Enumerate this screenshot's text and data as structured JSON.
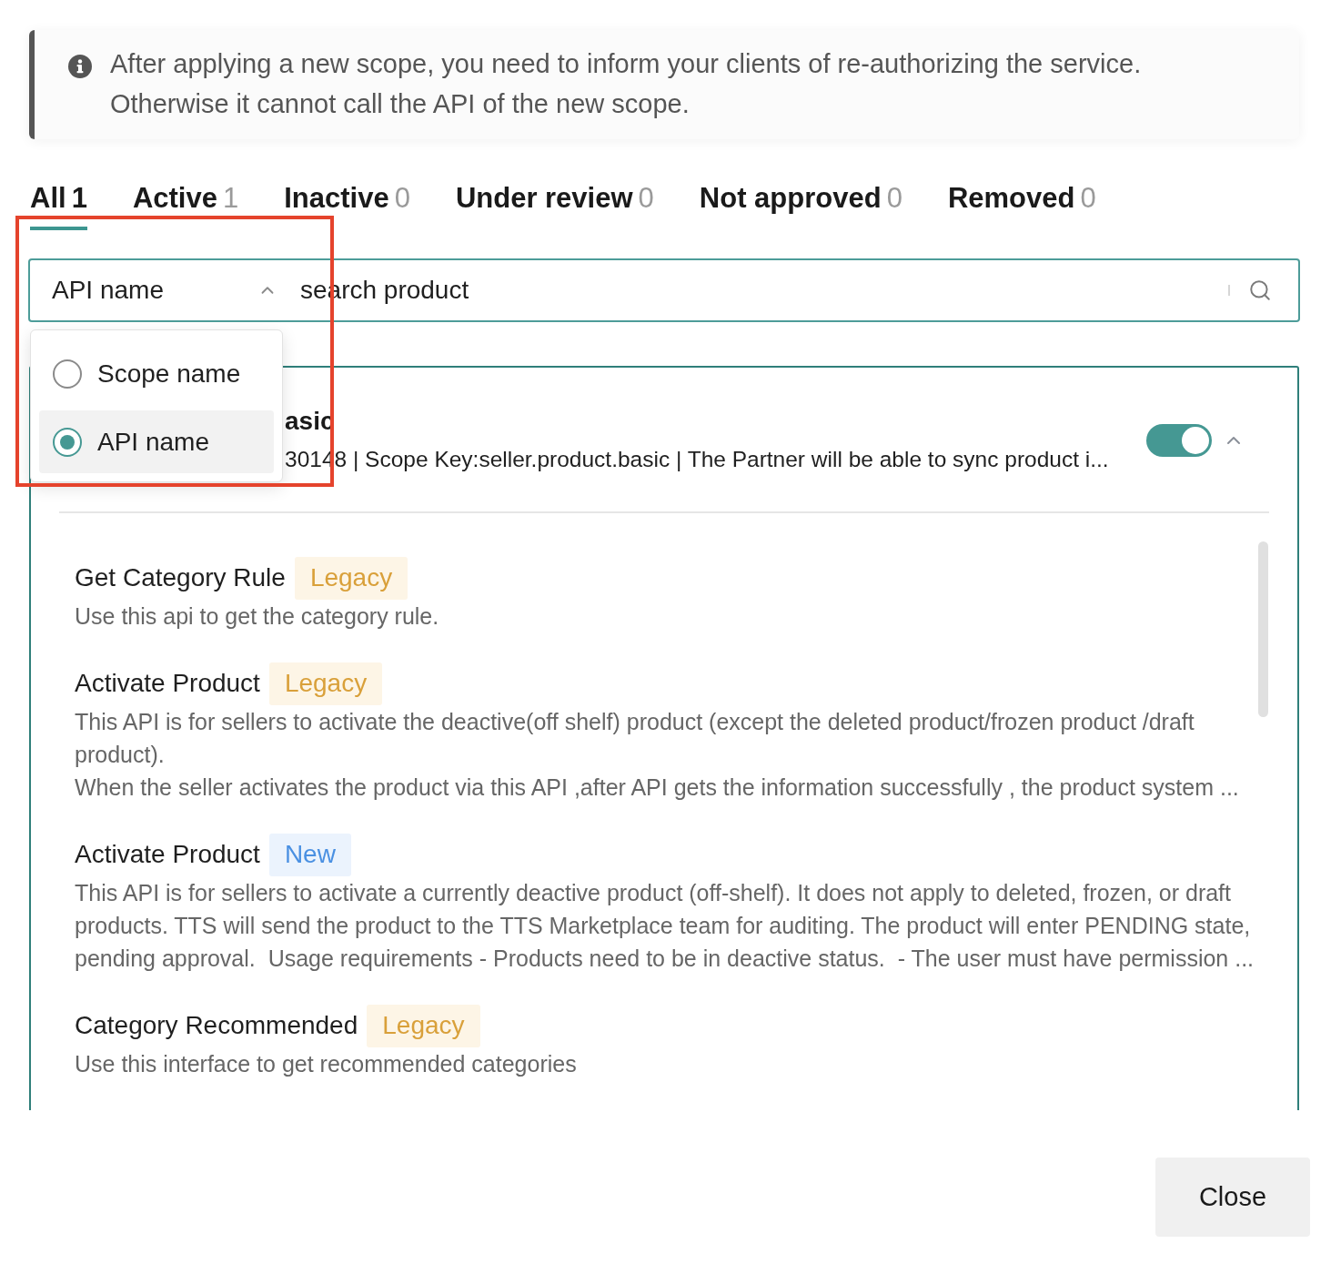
{
  "notice": {
    "text": "After applying a new scope, you need to inform your clients of re-authorizing the service.\nOtherwise it cannot call the API of the new scope."
  },
  "tabs": [
    {
      "label": "All",
      "count": "1",
      "selected": true
    },
    {
      "label": "Active",
      "count": "1",
      "selected": false
    },
    {
      "label": "Inactive",
      "count": "0",
      "selected": false
    },
    {
      "label": "Under review",
      "count": "0",
      "selected": false
    },
    {
      "label": "Not approved",
      "count": "0",
      "selected": false
    },
    {
      "label": "Removed",
      "count": "0",
      "selected": false
    }
  ],
  "search": {
    "field_type": "API name",
    "expanded": true,
    "value": "search product",
    "options": [
      {
        "label": "Scope name",
        "selected": false
      },
      {
        "label": "API name",
        "selected": true
      }
    ]
  },
  "scope_card": {
    "title": "asic",
    "subtitle": "30148 | Scope Key:seller.product.basic | The Partner will be able to sync product i...",
    "enabled": true,
    "expanded": true,
    "apis": [
      {
        "name": "Get Category Rule",
        "tag": {
          "label": "Legacy",
          "kind": "legacy"
        },
        "description": "Use this api to get the category rule."
      },
      {
        "name": "Activate Product",
        "tag": {
          "label": "Legacy",
          "kind": "legacy"
        },
        "description": "This API is for sellers to activate the deactive(off shelf) product (except the deleted product/frozen product /draft product).\nWhen the seller activates the product via this API ,after API gets the information successfully , the product system ..."
      },
      {
        "name": "Activate Product",
        "tag": {
          "label": "New",
          "kind": "new"
        },
        "description": "This API is for sellers to activate a currently deactive product (off-shelf). It does not apply to deleted, frozen, or draft products. TTS will send the product to the TTS Marketplace team for auditing. The product will enter PENDING state, pending approval.  Usage requirements - Products need to be in deactive status.  - The user must have permission ..."
      },
      {
        "name": "Category Recommended",
        "tag": {
          "label": "Legacy",
          "kind": "legacy"
        },
        "description": "Use this interface to get recommended categories"
      }
    ]
  },
  "footer": {
    "buttons": [
      "Close"
    ]
  }
}
